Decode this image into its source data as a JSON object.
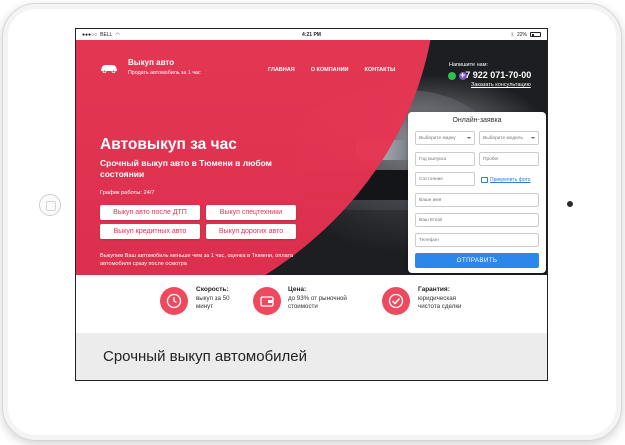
{
  "status_bar": {
    "carrier": "BELL",
    "time": "4:21 PM",
    "battery": "22%"
  },
  "header": {
    "logo_title": "Выкуп авто",
    "logo_subtitle": "Продать автомобиль за 1 час",
    "nav": [
      "ГЛАВНАЯ",
      "О КОМПАНИИ",
      "КОНТАКТЫ"
    ],
    "contact_label": "Напишите нам:",
    "phone": "+7 922 071-70-00",
    "order_call": "Заказать консультацию"
  },
  "hero": {
    "title": "Автовыкуп за час",
    "subtitle": "Срочный выкуп авто в Тюмени в любом состоянии",
    "schedule": "График работы: 24/7",
    "buttons": [
      "Выкуп авто после ДТП",
      "Выкуп спецтехники",
      "Выкуп кредитных авто",
      "Выкуп дорогих авто"
    ],
    "note": "Выкупим Ваш автомобиль меньше чем за 1 час, оценка в Тюмени, оплата автомобиля сразу после осмотра"
  },
  "form": {
    "title": "Онлайн-заявка",
    "brand_placeholder": "Выберите марку",
    "model_placeholder": "Выберите модель",
    "year_placeholder": "Год выпуска",
    "mileage_placeholder": "Пробег",
    "condition_placeholder": "Состояние",
    "attach_label": "Прикрепить фото",
    "name_placeholder": "Ваше имя",
    "email_placeholder": "Ваш Email",
    "phone_placeholder": "Телефон",
    "submit_label": "ОТПРАВИТЬ"
  },
  "features": [
    {
      "label": "Скорость:",
      "text": "выкуп за 50 минут",
      "icon": "clock-icon"
    },
    {
      "label": "Цена:",
      "text": "до 93% от рыночной стоимости",
      "icon": "wallet-icon"
    },
    {
      "label": "Гарантия:",
      "text": "юридическая чистота сделки",
      "icon": "check-icon"
    }
  ],
  "section_title": "Срочный выкуп автомобилей",
  "colors": {
    "accent": "#e8385a",
    "button_blue": "#2b88ea"
  }
}
